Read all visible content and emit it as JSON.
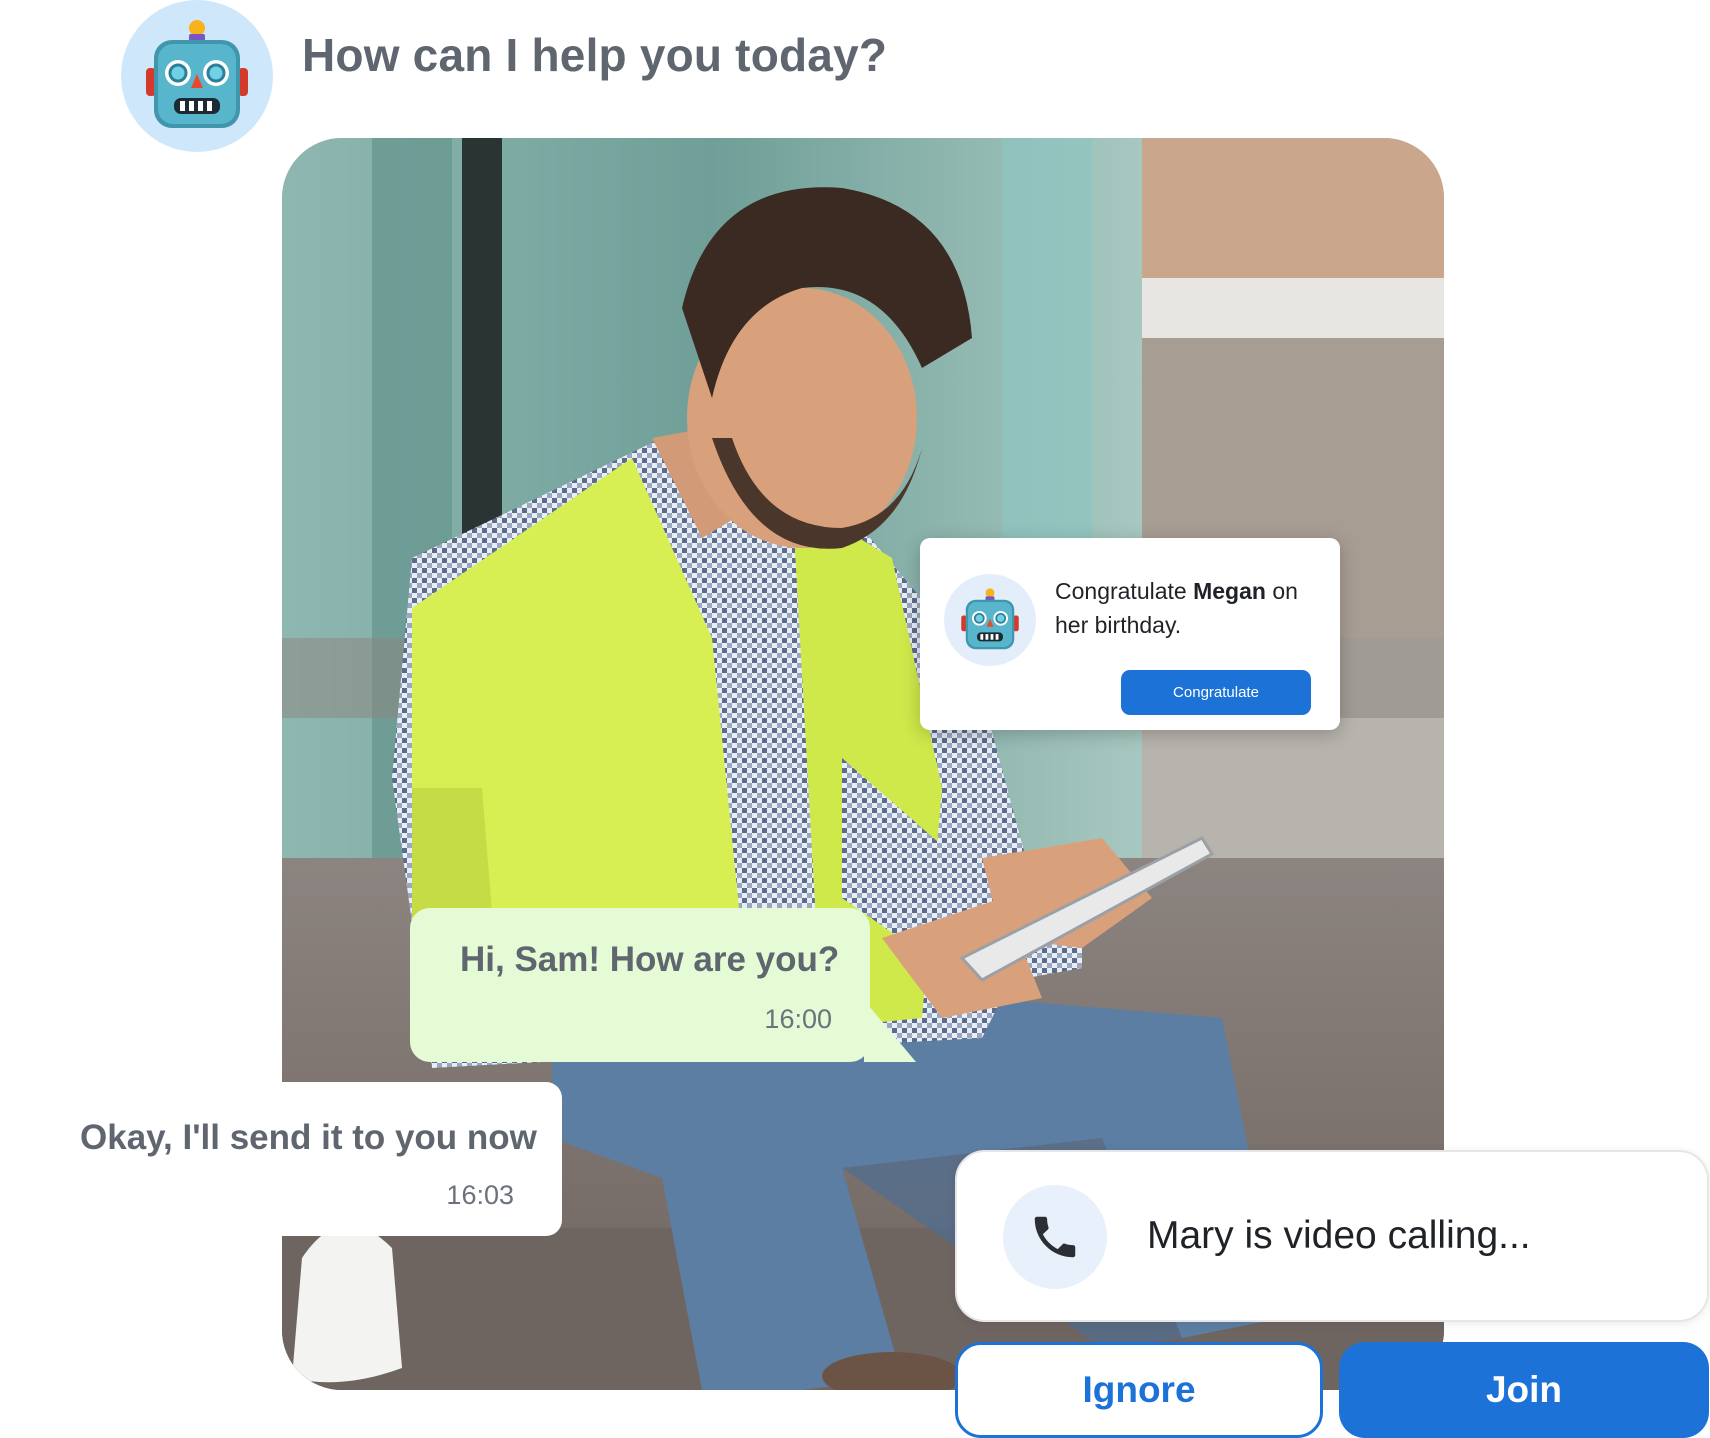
{
  "header": {
    "title": "How can I help you today?"
  },
  "notification": {
    "text_before": "Congratulate ",
    "name": "Megan",
    "text_after": " on her birthday.",
    "button_label": "Congratulate"
  },
  "messages": [
    {
      "text": "Hi, Sam! How are you?",
      "time": "16:00"
    },
    {
      "text": "Okay, I'll send it to you now",
      "time": "16:03"
    }
  ],
  "call": {
    "text": "Mary is video calling...",
    "ignore_label": "Ignore",
    "join_label": "Join"
  },
  "icons": {
    "assistant_avatar": "robot-icon",
    "call": "phone-icon"
  },
  "colors": {
    "accent": "#1c72d6",
    "incoming_bubble": "#e4fbd5",
    "avatar_bg": "#cfe7fb"
  }
}
